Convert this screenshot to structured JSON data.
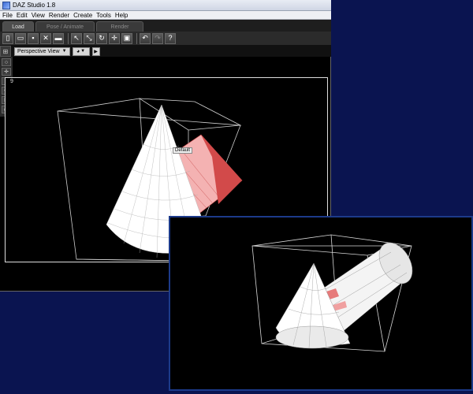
{
  "window": {
    "title": "DAZ Studio 1.8"
  },
  "menu": [
    "File",
    "Edit",
    "View",
    "Render",
    "Create",
    "Tools",
    "Help"
  ],
  "tabs": [
    {
      "label": "Load",
      "active": true
    },
    {
      "label": "Pose / Animate",
      "active": false
    },
    {
      "label": "Render",
      "active": false
    }
  ],
  "toolbar": {
    "icons": [
      "new-file-icon",
      "open-folder-icon",
      "save-icon",
      "delete-icon",
      "import-icon",
      "select-arrow-icon",
      "node-select-icon",
      "rotate-icon",
      "translate-icon",
      "scale-icon",
      "undo-icon",
      "redo-icon",
      "help-icon"
    ]
  },
  "viewbar": {
    "view_label": "Perspective View"
  },
  "viewport": {
    "number": "9",
    "tooltip": "Default"
  },
  "colors": {
    "background": "#0a1450",
    "shape_white": "#ffffff",
    "shape_red": "#e05a5a"
  }
}
